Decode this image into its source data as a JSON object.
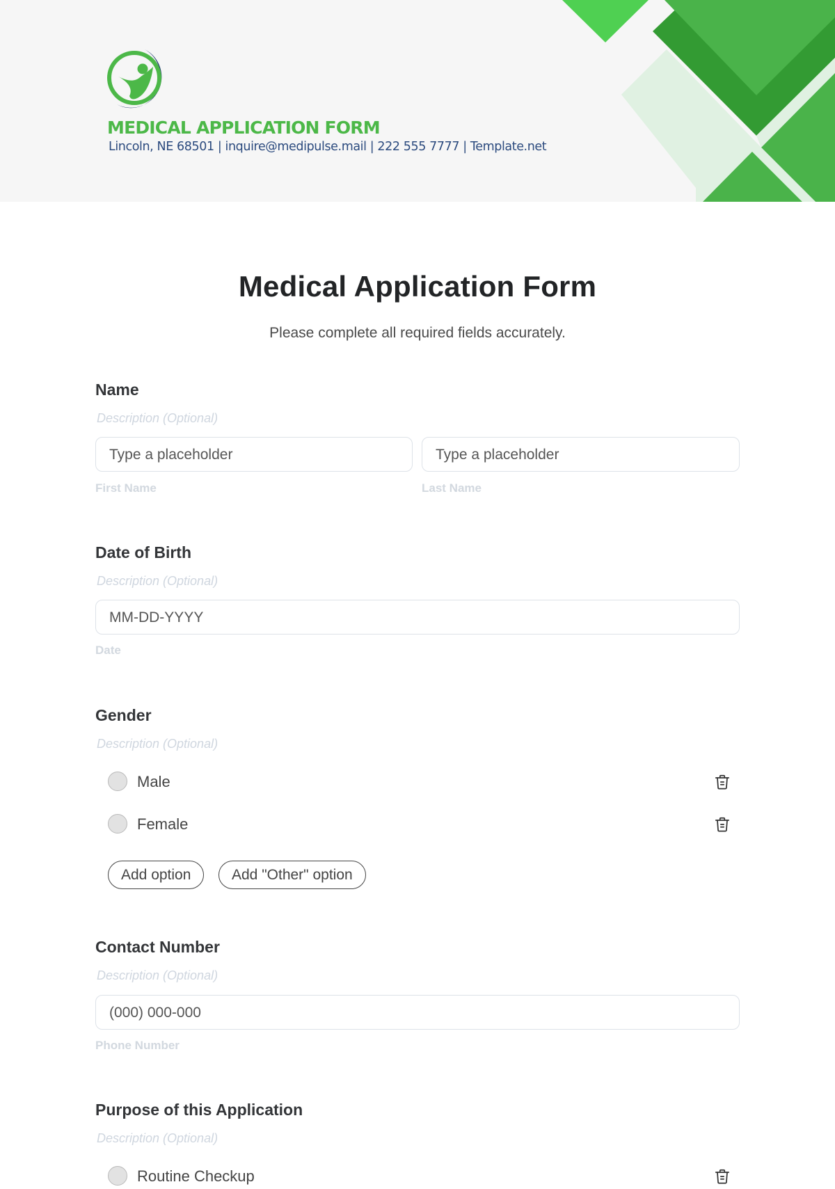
{
  "header": {
    "brand_title": "MEDICAL APPLICATION FORM",
    "contact_line": "Lincoln, NE 68501 | inquire@medipulse.mail | 222 555 7777 | Template.net",
    "logo_icon": "person-circle-logo-icon",
    "colors": {
      "brand_green": "#4cb848",
      "brand_navy": "#1f3a6e",
      "bright_green": "#4fd052",
      "dark_green": "#339b33",
      "medium_green": "#4ab34a",
      "mint": "#e0f1e2"
    }
  },
  "form": {
    "title": "Medical Application Form",
    "subtitle": "Please complete all required fields accurately.",
    "questions": [
      {
        "label": "Name",
        "description_placeholder": "Description (Optional)",
        "type": "name",
        "fields": [
          {
            "placeholder": "Type a placeholder",
            "sub_label": "First Name"
          },
          {
            "placeholder": "Type a placeholder",
            "sub_label": "Last Name"
          }
        ]
      },
      {
        "label": "Date of Birth",
        "description_placeholder": "Description (Optional)",
        "type": "date",
        "fields": [
          {
            "placeholder": "MM-DD-YYYY",
            "sub_label": "Date"
          }
        ]
      },
      {
        "label": "Gender",
        "description_placeholder": "Description (Optional)",
        "type": "radio",
        "options": [
          {
            "label": "Male",
            "selected": false
          },
          {
            "label": "Female",
            "selected": false
          }
        ],
        "add_option_label": "Add option",
        "add_other_option_label": "Add \"Other\" option"
      },
      {
        "label": "Contact Number",
        "description_placeholder": "Description (Optional)",
        "type": "phone",
        "fields": [
          {
            "placeholder": "(000) 000-000",
            "sub_label": "Phone Number"
          }
        ]
      },
      {
        "label": "Purpose of this Application",
        "description_placeholder": "Description (Optional)",
        "type": "radio",
        "options": [
          {
            "label": "Routine Checkup",
            "selected": false
          }
        ]
      }
    ]
  }
}
